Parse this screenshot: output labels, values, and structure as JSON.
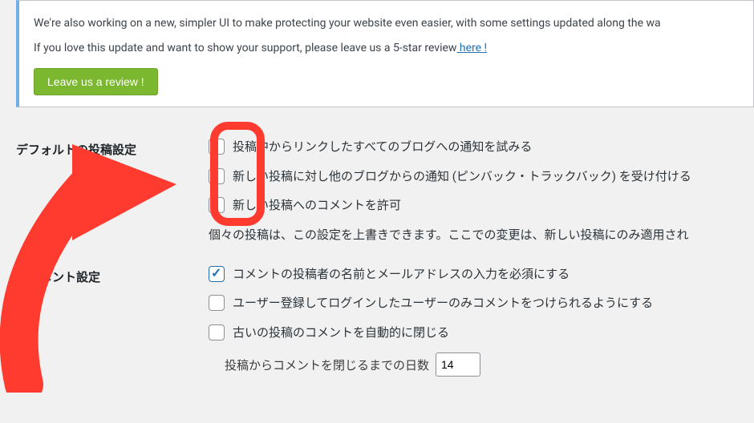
{
  "notice": {
    "line1": "We're also working on a new, simpler UI to make protecting your website even easier, with some settings updated along the wa",
    "line2_pre": "If you love this update and want to show your support, please leave us a 5-star review",
    "line2_link": " here !",
    "button": "Leave us a review !"
  },
  "sections": {
    "default_post": {
      "title": "デフォルトの投稿設定",
      "opt1": "投稿中からリンクしたすべてのブログへの通知を試みる",
      "opt2": "新しい投稿に対し他のブログからの通知 (ピンバック・トラックバック) を受け付ける",
      "opt3": "新しい投稿へのコメントを許可",
      "note": "個々の投稿は、この設定を上書きできます。ここでの変更は、新しい投稿にのみ適用され"
    },
    "other_comment": {
      "title": "のコメント設定",
      "opt1": "コメントの投稿者の名前とメールアドレスの入力を必須にする",
      "opt2": "ユーザー登録してログインしたユーザーのみコメントをつけられるようにする",
      "opt3": "古いの投稿のコメントを自動的に閉じる",
      "days_label": "投稿からコメントを閉じるまでの日数",
      "days_value": "14"
    }
  }
}
